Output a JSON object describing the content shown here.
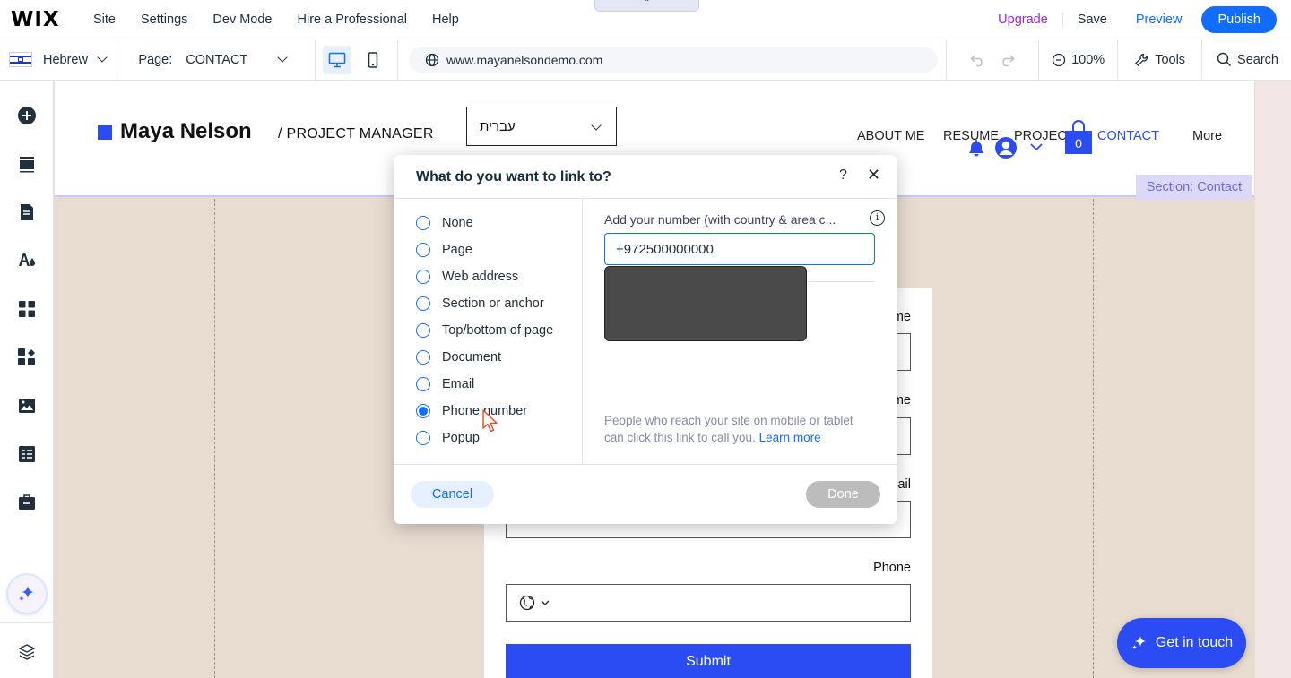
{
  "app": {
    "logo": "WIX",
    "menu": [
      "Site",
      "Settings",
      "Dev Mode",
      "Hire a Professional",
      "Help"
    ],
    "upgrade": "Upgrade",
    "save": "Save",
    "preview": "Preview",
    "publish": "Publish",
    "collapse_glyph": "⌃"
  },
  "toolbar": {
    "language": "Hebrew",
    "page_label": "Page:",
    "page_value": "CONTACT",
    "url": "www.mayanelsondemo.com",
    "zoom": "100%",
    "tools": "Tools",
    "search": "Search"
  },
  "site": {
    "name": "Maya Nelson",
    "role": "/ PROJECT MANAGER",
    "language_select": "עברית",
    "nav": [
      "ABOUT ME",
      "RESUME",
      "PROJECT",
      "CONTACT",
      "More"
    ],
    "cart_count": "0",
    "section_tag": "Section: Contact",
    "form": {
      "label_1": "me",
      "label_2": "me",
      "label_3": "ail",
      "phone_label": "Phone",
      "submit": "Submit"
    },
    "cta": "Get in touch"
  },
  "dialog": {
    "title": "What do you want to link to?",
    "help": "?",
    "close": "✕",
    "options": [
      "None",
      "Page",
      "Web address",
      "Section or anchor",
      "Top/bottom of page",
      "Document",
      "Email",
      "Phone number",
      "Popup"
    ],
    "selected_option": "Phone number",
    "field_label": "Add your number (with country & area c...",
    "phone_value": "+972500000000",
    "hint": "People who reach your site on mobile or tablet can click this link to call you.",
    "learn_more": "Learn more",
    "cancel": "Cancel",
    "done": "Done"
  },
  "colors": {
    "accent": "#116dff",
    "site_accent": "#2b4cf3",
    "upgrade": "#9a27d5",
    "canvas": "#e8dcd1"
  }
}
